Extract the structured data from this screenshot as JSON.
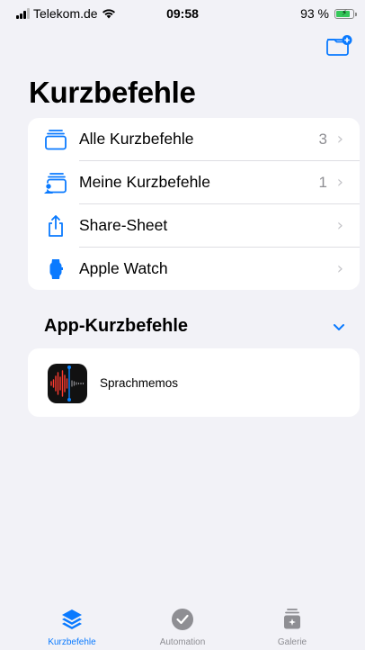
{
  "status_bar": {
    "carrier": "Telekom.de",
    "time": "09:58",
    "battery": "93 %",
    "battery_level": 0.93
  },
  "page_title": "Kurzbefehle",
  "main_list": [
    {
      "label": "Alle Kurzbefehle",
      "count": "3",
      "icon": "stack-icon"
    },
    {
      "label": "Meine Kurzbefehle",
      "count": "1",
      "icon": "person-stack-icon"
    },
    {
      "label": "Share-Sheet",
      "count": "",
      "icon": "share-icon"
    },
    {
      "label": "Apple Watch",
      "count": "",
      "icon": "watch-icon"
    }
  ],
  "section": {
    "title": "App-Kurzbefehle",
    "expanded": true
  },
  "apps": [
    {
      "name": "Sprachmemos",
      "icon": "voice-memos-icon"
    }
  ],
  "tabs": [
    {
      "label": "Kurzbefehle",
      "icon": "layers-icon",
      "active": true
    },
    {
      "label": "Automation",
      "icon": "clock-check-icon",
      "active": false
    },
    {
      "label": "Galerie",
      "icon": "gallery-icon",
      "active": false
    }
  ],
  "colors": {
    "accent": "#0a7aff",
    "background": "#f2f2f7",
    "inactive": "#8e8e93"
  }
}
